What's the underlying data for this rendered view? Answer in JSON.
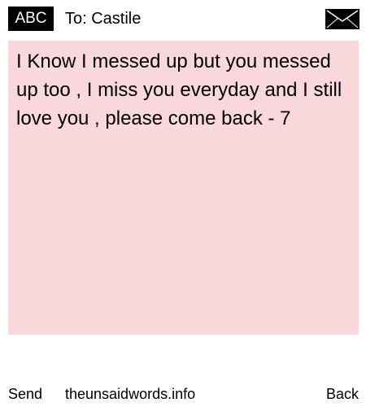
{
  "header": {
    "input_mode": "ABC",
    "recipient": "To: Castile",
    "envelope_icon": "envelope-icon"
  },
  "message": {
    "text": "I Know I messed up but you messed up too , I miss you everyday and I still love you , please come back - 7",
    "background_color": "#f9d8dc"
  },
  "footer": {
    "left_softkey": "Send",
    "site": "theunsaidwords.info",
    "right_softkey": "Back"
  }
}
